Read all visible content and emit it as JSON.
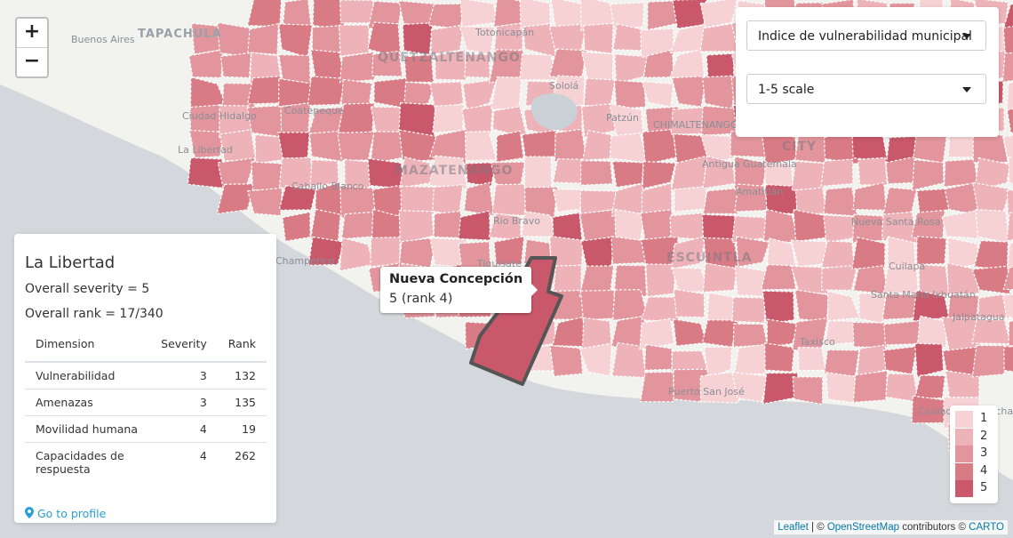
{
  "map": {
    "place_labels": [
      {
        "text": "Buenos Aires",
        "kind": "small"
      },
      {
        "text": "TAPACHULA",
        "kind": "big"
      },
      {
        "text": "Ciudad Hidalgo",
        "kind": "small"
      },
      {
        "text": "La Libertad",
        "kind": "small"
      },
      {
        "text": "QUETZALTENANGO",
        "kind": "region"
      },
      {
        "text": "MAZATENANGO",
        "kind": "region"
      },
      {
        "text": "ESCUINTLA",
        "kind": "region"
      },
      {
        "text": "CITY",
        "kind": "region"
      },
      {
        "text": "Coatepeque",
        "kind": "small"
      },
      {
        "text": "Caballo Blanco",
        "kind": "small"
      },
      {
        "text": "Champerico",
        "kind": "small"
      },
      {
        "text": "Rio Bravo",
        "kind": "small"
      },
      {
        "text": "Tiquisate",
        "kind": "small"
      },
      {
        "text": "Puerto San José",
        "kind": "small"
      },
      {
        "text": "Taxisco",
        "kind": "small"
      },
      {
        "text": "Cuilapa",
        "kind": "small"
      },
      {
        "text": "Jalpatagua",
        "kind": "small"
      },
      {
        "text": "Santa María Ixhuatán",
        "kind": "small"
      },
      {
        "text": "Nueva Santa Rosa",
        "kind": "small"
      },
      {
        "text": "Totonicapán",
        "kind": "small"
      },
      {
        "text": "Sololá",
        "kind": "small"
      },
      {
        "text": "Patzún",
        "kind": "small"
      },
      {
        "text": "CHIMALTENANGO",
        "kind": "small"
      },
      {
        "text": "Antigua Guatemala",
        "kind": "small"
      },
      {
        "text": "Amatitlán",
        "kind": "small"
      },
      {
        "text": "Ciudad de Ahuachapán",
        "kind": "small"
      }
    ],
    "choropleth_colors": [
      "#f6d2d5",
      "#eeb3b9",
      "#e2959c",
      "#d97b85",
      "#c8586a"
    ],
    "highlighted_region_stroke": "#555555"
  },
  "zoom": {
    "in_label": "+",
    "out_label": "−"
  },
  "controls": {
    "indicator_select": "Indice de vulnerabilidad municipal",
    "scale_select": "1-5 scale"
  },
  "info_panel": {
    "title": "La Libertad",
    "overall_severity": "Overall severity = 5",
    "overall_rank": "Overall rank = 17/340",
    "table": {
      "headers": [
        "Dimension",
        "Severity",
        "Rank"
      ],
      "rows": [
        {
          "dimension": "Vulnerabilidad",
          "severity": "3",
          "rank": "132"
        },
        {
          "dimension": "Amenazas",
          "severity": "3",
          "rank": "135"
        },
        {
          "dimension": "Movilidad humana",
          "severity": "4",
          "rank": "19"
        },
        {
          "dimension": "Capacidades de respuesta",
          "severity": "4",
          "rank": "262"
        }
      ]
    },
    "profile_link": "Go to profile",
    "profile_icon": "map-marker-icon"
  },
  "tooltip": {
    "name": "Nueva Concepción",
    "value": "5 (rank 4)"
  },
  "legend": {
    "items": [
      {
        "label": "1",
        "color": "#f6d2d5"
      },
      {
        "label": "2",
        "color": "#eeb3b9"
      },
      {
        "label": "3",
        "color": "#e2959c"
      },
      {
        "label": "4",
        "color": "#d97b85"
      },
      {
        "label": "5",
        "color": "#c8586a"
      }
    ]
  },
  "attribution": {
    "leaflet": "Leaflet",
    "sep": " | © ",
    "osm": "OpenStreetMap",
    "mid": " contributors © ",
    "carto": "CARTO"
  }
}
